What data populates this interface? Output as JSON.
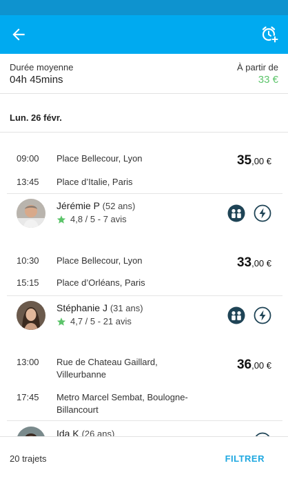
{
  "colors": {
    "appbar": "#00aaf0",
    "statusbar": "#0e93cf",
    "price_green": "#5cc46a",
    "star_green": "#5cc46a",
    "filter_blue": "#1fa8e0"
  },
  "header": {
    "back_icon": "arrow-left-icon",
    "alarm_icon": "alarm-add-icon"
  },
  "summary": {
    "duration_label": "Durée moyenne",
    "duration_value": "04h 45mins",
    "from_label": "À partir de",
    "from_value": "33 €"
  },
  "date": "Lun. 26 févr.",
  "trips": [
    {
      "departure_time": "09:00",
      "departure_place": "Place Bellecour, Lyon",
      "arrival_time": "13:45",
      "arrival_place": "Place d’Italie, Paris",
      "price_int": "35",
      "price_dec": ",00 €",
      "driver": {
        "name": "Jérémie P",
        "age": "(52 ans)",
        "rating": "4,8 / 5 - 7 avis"
      }
    },
    {
      "departure_time": "10:30",
      "departure_place": "Place Bellecour, Lyon",
      "arrival_time": "15:15",
      "arrival_place": "Place d’Orléans, Paris",
      "price_int": "33",
      "price_dec": ",00 €",
      "driver": {
        "name": "Stéphanie J",
        "age": "(31 ans)",
        "rating": "4,7 / 5 - 21 avis"
      }
    },
    {
      "departure_time": "13:00",
      "departure_place": "Rue de Chateau Gaillard, Villeurbanne",
      "arrival_time": "17:45",
      "arrival_place": "Metro Marcel Sembat, Boulogne-Billancourt",
      "price_int": "36",
      "price_dec": ",00 €",
      "driver": {
        "name": "Ida K",
        "age": "(26 ans)",
        "rating": ""
      }
    }
  ],
  "footer": {
    "count": "20 trajets",
    "filter": "FILTRER"
  }
}
